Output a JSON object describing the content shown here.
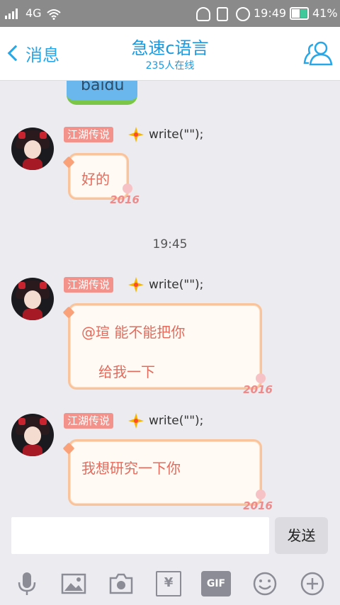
{
  "status_bar": {
    "network": "4G",
    "time": "19:49",
    "battery": "41%",
    "battery_level": 0.41,
    "icons": [
      "signal-icon",
      "wifi-icon",
      "headset-icon",
      "vibrate-icon",
      "alarm-icon",
      "battery-icon"
    ]
  },
  "header": {
    "back_label": "消息",
    "title": "急速c语言",
    "subtitle": "235人在线",
    "members_icon": "group-members-icon"
  },
  "chat": {
    "sticker_text": "baidu",
    "timestamp": "19:45",
    "messages": [
      {
        "tag": "江湖传说",
        "nickname": "write(\"\");",
        "lines": [
          "好的"
        ],
        "deco": "2016"
      },
      {
        "tag": "江湖传说",
        "nickname": "write(\"\");",
        "lines": [
          "@瑄 能不能把你",
          "给我一下"
        ],
        "deco": "2016"
      },
      {
        "tag": "江湖传说",
        "nickname": "write(\"\");",
        "lines": [
          "我想研究一下你"
        ],
        "deco": "2016"
      }
    ]
  },
  "composer": {
    "input_value": "",
    "send_label": "发送"
  },
  "toolbar": {
    "items": [
      "microphone-icon",
      "image-icon",
      "camera-icon",
      "red-packet-icon",
      "gif-icon",
      "emoji-icon",
      "plus-icon"
    ],
    "gif_label": "GIF",
    "red_packet_label": "¥"
  },
  "colors": {
    "accent": "#1b9ae0",
    "tag_bg": "#f2928a",
    "bubble_border": "#f9c49c",
    "bubble_text": "#e36b5d",
    "status_bar": "#8a8a8a"
  }
}
